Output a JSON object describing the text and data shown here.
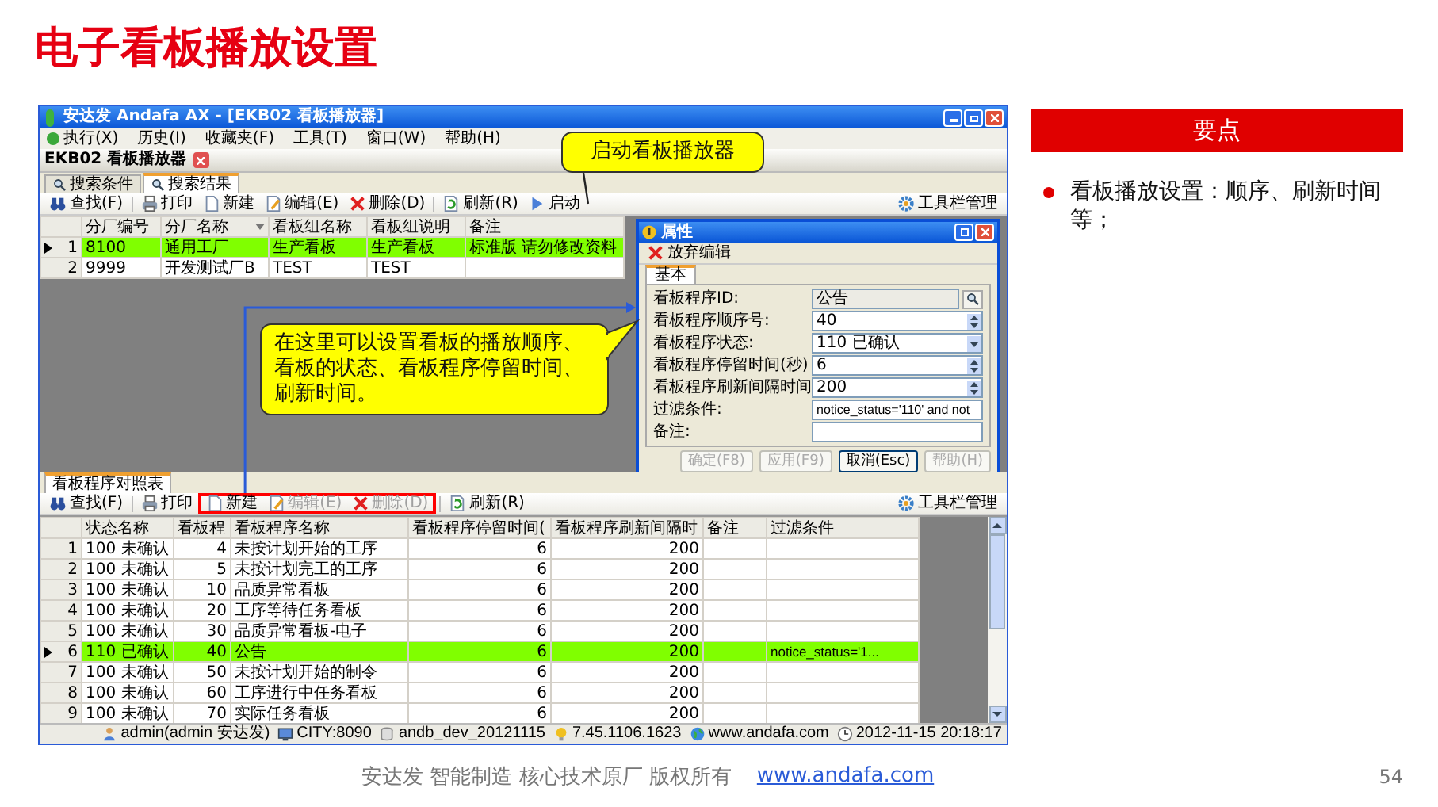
{
  "title": "电子看板播放设置",
  "app": {
    "title": "安达发 Andafa AX - [EKB02 看板播放器]",
    "menu": [
      "执行(X)",
      "历史(I)",
      "收藏夹(F)",
      "工具(T)",
      "窗口(W)",
      "帮助(H)"
    ],
    "document_tab": "EKB02 看板播放器",
    "search_tabs": [
      {
        "label": "搜索条件",
        "selected": false
      },
      {
        "label": "搜索结果",
        "selected": true
      }
    ],
    "toolbar": {
      "items": [
        {
          "kind": "find",
          "label": "查找(F)",
          "disabled": false
        },
        {
          "kind": "print",
          "label": "打印",
          "disabled": false
        },
        {
          "kind": "new",
          "label": "新建",
          "disabled": false
        },
        {
          "kind": "edit",
          "label": "编辑(E)",
          "disabled": false
        },
        {
          "kind": "delete",
          "label": "删除(D)",
          "disabled": false
        },
        {
          "kind": "refresh",
          "label": "刷新(R)",
          "disabled": false
        },
        {
          "kind": "start",
          "label": "启动",
          "disabled": false
        }
      ],
      "manage": "工具栏管理"
    },
    "grid": {
      "columns": [
        {
          "label": "分厂编号",
          "sorted": false
        },
        {
          "label": "分厂名称",
          "sorted": true
        },
        {
          "label": "看板组名称",
          "sorted": false
        },
        {
          "label": "看板组说明",
          "sorted": false
        },
        {
          "label": "备注",
          "sorted": false
        }
      ],
      "rows": [
        {
          "number": "1",
          "selected": true,
          "cells": [
            "8100",
            "通用工厂",
            "生产看板",
            "生产看板",
            "标准版 请勿修改资料"
          ]
        },
        {
          "number": "2",
          "selected": false,
          "cells": [
            "9999",
            "开发测试厂B",
            "TEST",
            "TEST",
            null
          ]
        }
      ]
    },
    "dialog": {
      "title": "属性",
      "discard": "放弃编辑",
      "tabs": [
        {
          "label": "基本",
          "selected": true
        }
      ],
      "fields": [
        {
          "kind": "lookup",
          "label": "看板程序ID:",
          "value": "公告"
        },
        {
          "kind": "spin",
          "label": "看板程序顺序号:",
          "value": "40"
        },
        {
          "kind": "select",
          "label": "看板程序状态:",
          "value": "110 已确认"
        },
        {
          "kind": "spin",
          "label": "看板程序停留时间(秒)",
          "value": "6"
        },
        {
          "kind": "spin",
          "label": "看板程序刷新间隔时间",
          "value": "200"
        },
        {
          "kind": "code",
          "label": "过滤条件:",
          "value": "notice_status='110' and not"
        },
        {
          "kind": "text",
          "label": "备注:"
        }
      ],
      "buttons": [
        {
          "label": "确定(F8)",
          "disabled": true
        },
        {
          "label": "应用(F9)",
          "disabled": true
        },
        {
          "label": "取消(Esc)",
          "disabled": false
        },
        {
          "label": "帮助(H)",
          "disabled": true
        }
      ]
    },
    "detail_tab": "看板程序对照表",
    "detail_toolbar": {
      "items": [
        {
          "kind": "find",
          "label": "查找(F)",
          "disabled": false,
          "highlighted": false
        },
        {
          "kind": "print",
          "label": "打印",
          "disabled": false,
          "highlighted": false
        },
        {
          "kind": "new",
          "label": "新建",
          "disabled": false,
          "highlighted": true
        },
        {
          "kind": "edit",
          "label": "编辑(E)",
          "disabled": true,
          "highlighted": true
        },
        {
          "kind": "delete",
          "label": "删除(D)",
          "disabled": true,
          "highlighted": true
        },
        {
          "kind": "refresh",
          "label": "刷新(R)",
          "disabled": false,
          "highlighted": false
        }
      ],
      "manage": "工具栏管理"
    },
    "detail_grid": {
      "columns": [
        {
          "label": "状态名称",
          "kind": "text",
          "sorted": false
        },
        {
          "label": "看板程",
          "kind": "number",
          "sorted": false
        },
        {
          "label": "看板程序名称",
          "kind": "text",
          "sorted": false
        },
        {
          "label": "看板程序停留时间(",
          "kind": "number",
          "sorted": false
        },
        {
          "label": "看板程序刷新间隔时",
          "kind": "number",
          "sorted": false
        },
        {
          "label": "备注",
          "kind": "text",
          "sorted": false
        },
        {
          "label": "过滤条件",
          "kind": "code",
          "sorted": false
        }
      ],
      "rows": [
        {
          "number": "1",
          "selected": false,
          "cells": [
            "100 未确认",
            "4",
            "未按计划开始的工序",
            "6",
            "200",
            null,
            null
          ]
        },
        {
          "number": "2",
          "selected": false,
          "cells": [
            "100 未确认",
            "5",
            "未按计划完工的工序",
            "6",
            "200",
            null,
            null
          ]
        },
        {
          "number": "3",
          "selected": false,
          "cells": [
            "100 未确认",
            "10",
            "品质异常看板",
            "6",
            "200",
            null,
            null
          ]
        },
        {
          "number": "4",
          "selected": false,
          "cells": [
            "100 未确认",
            "20",
            "工序等待任务看板",
            "6",
            "200",
            null,
            null
          ]
        },
        {
          "number": "5",
          "selected": false,
          "cells": [
            "100 未确认",
            "30",
            "品质异常看板-电子",
            "6",
            "200",
            null,
            null
          ]
        },
        {
          "number": "6",
          "selected": true,
          "cells": [
            "110 已确认",
            "40",
            "公告",
            "6",
            "200",
            null,
            "notice_status='1..."
          ]
        },
        {
          "number": "7",
          "selected": false,
          "cells": [
            "100 未确认",
            "50",
            "未按计划开始的制令",
            "6",
            "200",
            null,
            null
          ]
        },
        {
          "number": "8",
          "selected": false,
          "cells": [
            "100 未确认",
            "60",
            "工序进行中任务看板",
            "6",
            "200",
            null,
            null
          ]
        },
        {
          "number": "9",
          "selected": false,
          "cells": [
            "100 未确认",
            "70",
            "实际任务看板",
            "6",
            "200",
            null,
            null
          ]
        }
      ]
    },
    "status_bar": [
      {
        "kind": "user",
        "text": "admin(admin 安达发)"
      },
      {
        "kind": "server",
        "text": "CITY:8090"
      },
      {
        "kind": "database",
        "text": "andb_dev_20121115"
      },
      {
        "kind": "version",
        "text": "7.45.1106.1623"
      },
      {
        "kind": "web",
        "text": "www.andafa.com"
      },
      {
        "kind": "clock",
        "text": "2012-11-15 20:18:17"
      }
    ],
    "callouts": [
      {
        "text": "启动看板播放器"
      },
      {
        "text": "在这里可以设置看板的播放顺序、看板的状态、看板程序停留时间、刷新时间。"
      }
    ]
  },
  "key_points": {
    "heading": "要点",
    "items": [
      "看板播放设置：顺序、刷新时间等；"
    ]
  },
  "footer": {
    "text": "安达发 智能制造 核心技术原厂 版权所有",
    "link": "www.andafa.com",
    "page": "54"
  }
}
